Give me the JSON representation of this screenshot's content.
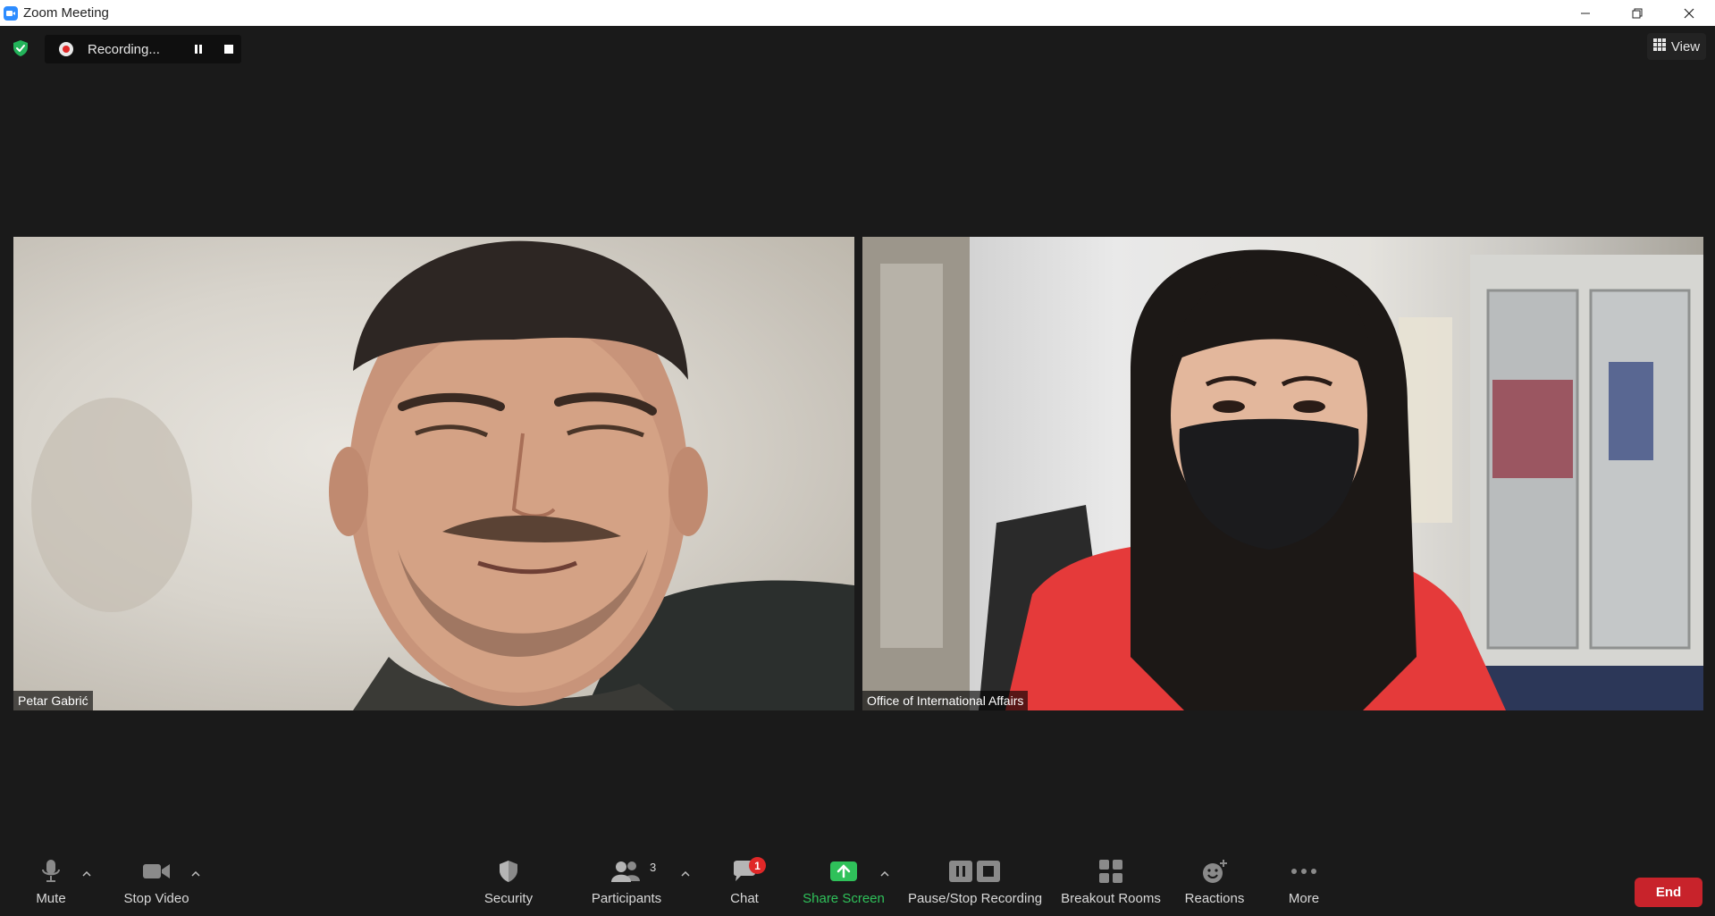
{
  "window": {
    "title": "Zoom Meeting"
  },
  "recording": {
    "status": "Recording..."
  },
  "top": {
    "view_label": "View"
  },
  "participants": [
    {
      "name": "Petar Gabrić"
    },
    {
      "name": "Office of International Affairs"
    }
  ],
  "toolbar": {
    "mute": "Mute",
    "stop_video": "Stop Video",
    "security": "Security",
    "participants": "Participants",
    "participants_count": "3",
    "chat": "Chat",
    "chat_badge": "1",
    "share_screen": "Share Screen",
    "pause_stop_recording": "Pause/Stop Recording",
    "breakout_rooms": "Breakout Rooms",
    "reactions": "Reactions",
    "more": "More",
    "end": "End"
  },
  "colors": {
    "background": "#1a1a1a",
    "end_button": "#c8232b",
    "share_green": "#2fc15a",
    "badge_red": "#e02828",
    "shield_green": "#23b35a"
  },
  "icons": [
    "zoom-app-icon",
    "minimize-icon",
    "restore-icon",
    "close-icon",
    "shield-check-icon",
    "record-dot-icon",
    "pause-icon",
    "stop-icon",
    "grid-view-icon",
    "microphone-icon",
    "video-camera-icon",
    "security-shield-icon",
    "participants-icon",
    "chat-bubble-icon",
    "share-screen-icon",
    "pause-stop-recording-icon",
    "breakout-rooms-icon",
    "reactions-icon",
    "more-dots-icon",
    "caret-up-icon"
  ]
}
